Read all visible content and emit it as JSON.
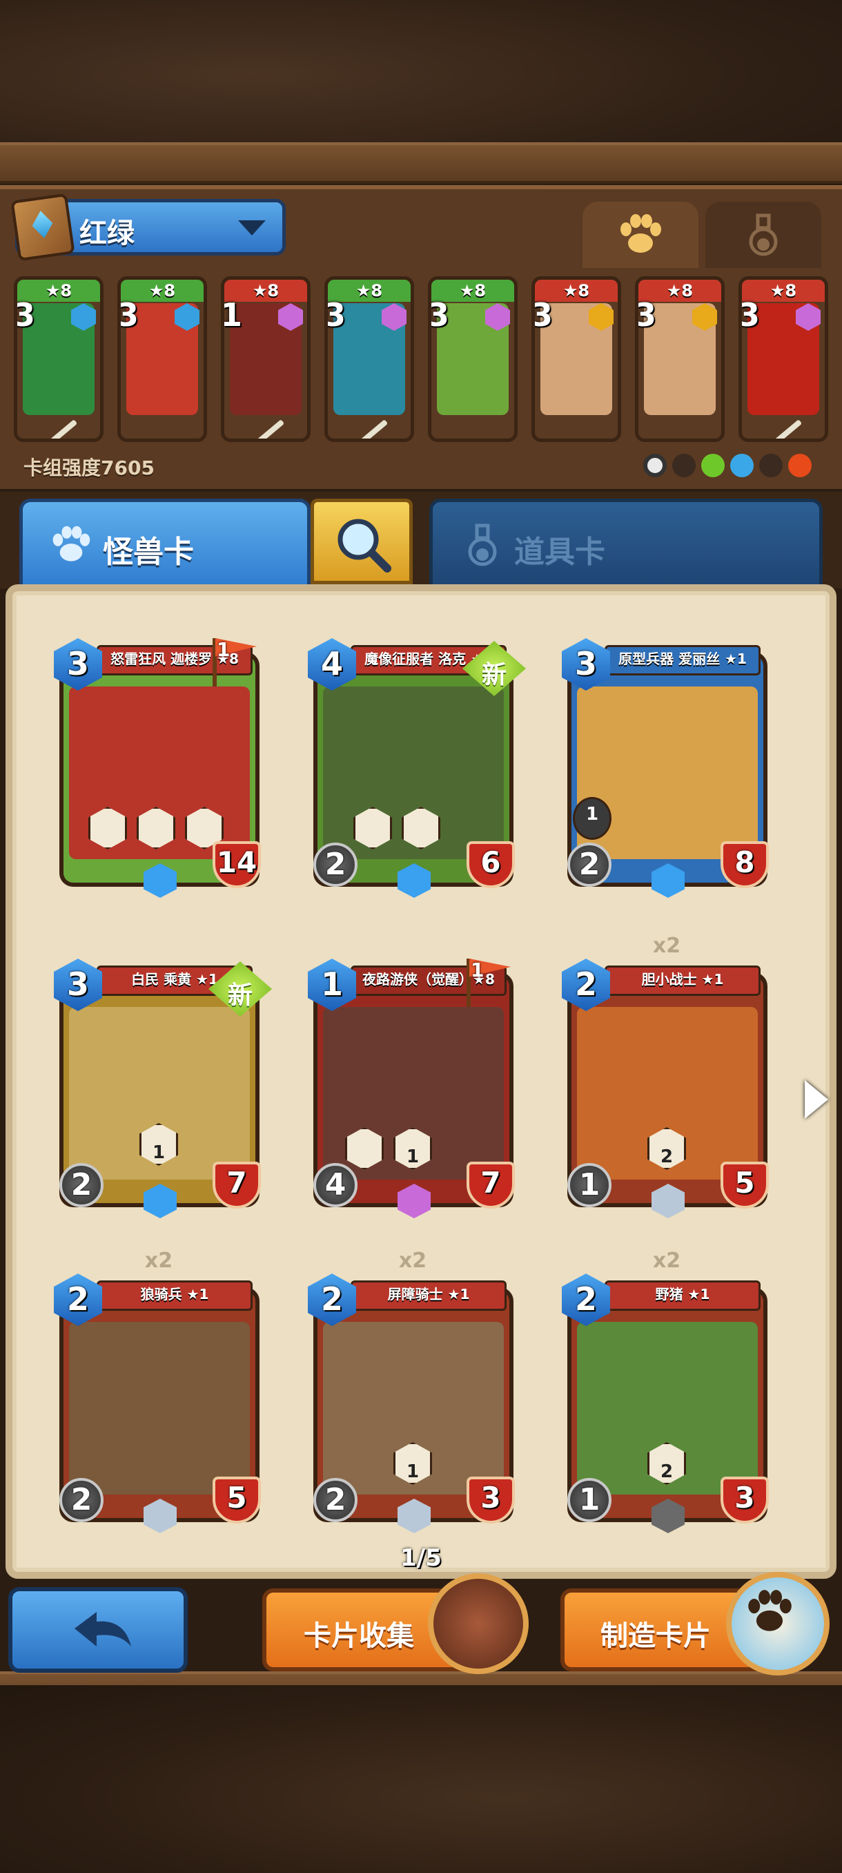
{
  "deck": {
    "name": "红绿",
    "strength_label": "卡组强度7605",
    "type_tabs": [
      "paw-icon",
      "potion-icon"
    ],
    "cards": [
      {
        "cost": "3",
        "stars": "★8",
        "frame": "green",
        "art": "#2f8c3f",
        "gem": "#36a0e0"
      },
      {
        "cost": "3",
        "stars": "★8",
        "frame": "green",
        "art": "#c83b2a",
        "gem": "#36a0e0"
      },
      {
        "cost": "1",
        "stars": "★8",
        "frame": "red",
        "art": "#7e2a22",
        "gem": "#c86bd8"
      },
      {
        "cost": "3",
        "stars": "★8",
        "frame": "green",
        "art": "#2a8aa0",
        "gem": "#c86bd8"
      },
      {
        "cost": "3",
        "stars": "★8",
        "frame": "green",
        "art": "#6fa83a",
        "gem": "#c86bd8"
      },
      {
        "cost": "3",
        "stars": "★8",
        "frame": "red",
        "art": "#d5a57a",
        "gem": "#e8a91a"
      },
      {
        "cost": "3",
        "stars": "★8",
        "frame": "red",
        "art": "#d5a57a",
        "gem": "#e8a91a"
      },
      {
        "cost": "3",
        "stars": "★8",
        "frame": "red",
        "art": "#c02418",
        "gem": "#c86bd8"
      }
    ],
    "elements": [
      "#eaeaea",
      "#3a2a20",
      "#6fc82a",
      "#3aa8e8",
      "#3a2a20",
      "#e84a1a"
    ]
  },
  "tabs": {
    "monster": "怪兽卡",
    "item": "道具卡"
  },
  "collection": {
    "page": "1/5",
    "cards": [
      {
        "name": "怒雷狂风 迦楼罗 ★8",
        "cost": "3",
        "atk": "",
        "hp": "14",
        "count": "",
        "flag": "1",
        "new": "",
        "frame": "#6aa83a",
        "art": "#b8352a",
        "rarity": "#3aa0f0",
        "abilities": [
          "",
          "",
          ""
        ]
      },
      {
        "name": "魔像征服者 洛克 ★1",
        "cost": "4",
        "atk": "2",
        "hp": "6",
        "count": "",
        "flag": "",
        "new": "新",
        "frame": "#5a8f2e",
        "art": "#4e6a32",
        "rarity": "#3aa0f0",
        "abilities": [
          "",
          ""
        ]
      },
      {
        "name": "原型兵器 爱丽丝 ★1",
        "cost": "3",
        "atk": "2",
        "hp": "8",
        "count": "",
        "flag": "",
        "new": "",
        "frame": "#2e6fb8",
        "art": "#d8a24a",
        "rarity": "#3aa0f0",
        "abilities": [
          "1"
        ]
      },
      {
        "name": "白民 乘黄 ★1",
        "cost": "3",
        "atk": "2",
        "hp": "7",
        "count": "",
        "flag": "",
        "new": "新",
        "frame": "#b08a2a",
        "art": "#c8a85a",
        "rarity": "#3aa0f0",
        "abilities": [
          "1"
        ]
      },
      {
        "name": "夜路游侠（觉醒）★8",
        "cost": "1",
        "atk": "4",
        "hp": "7",
        "count": "",
        "flag": "1",
        "new": "",
        "frame": "#9a2a20",
        "art": "#6a3a30",
        "rarity": "#c86bd8",
        "abilities": [
          "",
          "1"
        ]
      },
      {
        "name": "胆小战士 ★1",
        "cost": "2",
        "atk": "1",
        "hp": "5",
        "count": "x2",
        "flag": "",
        "new": "",
        "frame": "#9a3a22",
        "art": "#c8682a",
        "rarity": "#b8c8d8",
        "abilities": [
          "2"
        ]
      },
      {
        "name": "狼骑兵 ★1",
        "cost": "2",
        "atk": "2",
        "hp": "5",
        "count": "x2",
        "flag": "",
        "new": "",
        "frame": "#9a3a22",
        "art": "#7a5a3a",
        "rarity": "#b8c8d8",
        "abilities": []
      },
      {
        "name": "屏障骑士 ★1",
        "cost": "2",
        "atk": "2",
        "hp": "3",
        "count": "x2",
        "flag": "",
        "new": "",
        "frame": "#9a3a22",
        "art": "#8a6a4a",
        "rarity": "#b8c8d8",
        "abilities": [
          "1"
        ]
      },
      {
        "name": "野猪 ★1",
        "cost": "2",
        "atk": "1",
        "hp": "3",
        "count": "x2",
        "flag": "",
        "new": "",
        "frame": "#9a3a22",
        "art": "#5a8a3a",
        "rarity": "#6a6a6a",
        "abilities": [
          "2"
        ]
      }
    ]
  },
  "buttons": {
    "back": "back-arrow",
    "collect": "卡片收集",
    "craft": "制造卡片"
  }
}
